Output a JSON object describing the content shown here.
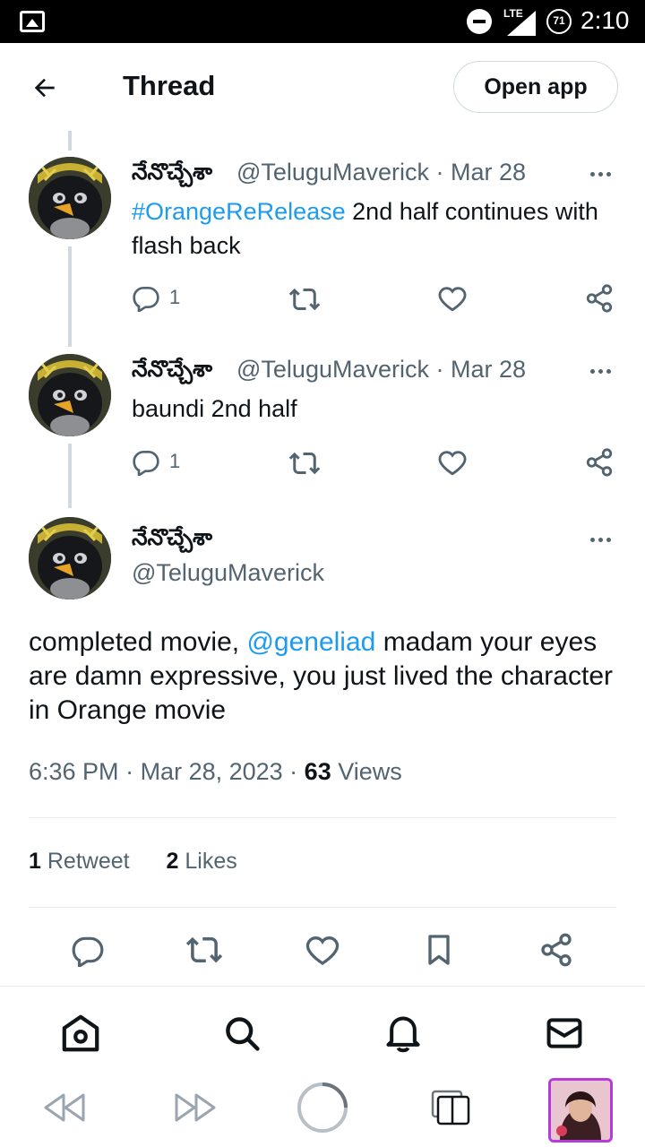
{
  "status_bar": {
    "network": "LTE",
    "battery": "71",
    "time": "2:10"
  },
  "header": {
    "title": "Thread",
    "open_app_label": "Open app"
  },
  "tweets": [
    {
      "name": "నేనొచ్చేశా",
      "handle": "@TeluguMaverick",
      "separator": " · ",
      "date": "Mar 28",
      "hashtag": "#OrangeReRelease",
      "text": " 2nd half continues with flash back",
      "reply_count": "1"
    },
    {
      "name": "నేనొచ్చేశా",
      "handle": "@TeluguMaverick",
      "separator": " · ",
      "date": "Mar 28",
      "text": "baundi 2nd half",
      "reply_count": "1"
    }
  ],
  "main_tweet": {
    "name": "నేనొచ్చేశా",
    "handle": "@TeluguMaverick",
    "text_before": "completed movie, ",
    "mention": "@geneliad",
    "text_after": " madam your eyes are damn expressive, you just lived the character in Orange movie",
    "time": "6:36 PM",
    "date": "Mar 28, 2023",
    "views_count": "63",
    "views_label": "Views",
    "retweet_count": "1",
    "retweet_label": "Retweet",
    "likes_count": "2",
    "likes_label": "Likes"
  },
  "colors": {
    "accent": "#1d9bf0",
    "text": "#0f1419",
    "muted": "#536471",
    "divider": "#e6ecf0",
    "thread_line": "#cfd9de"
  },
  "icons": {
    "bottom_nav": [
      "home-icon",
      "search-icon",
      "bell-icon",
      "mail-icon"
    ],
    "browser": [
      "back-icon",
      "forward-icon",
      "reload-icon",
      "tabs-icon"
    ]
  }
}
